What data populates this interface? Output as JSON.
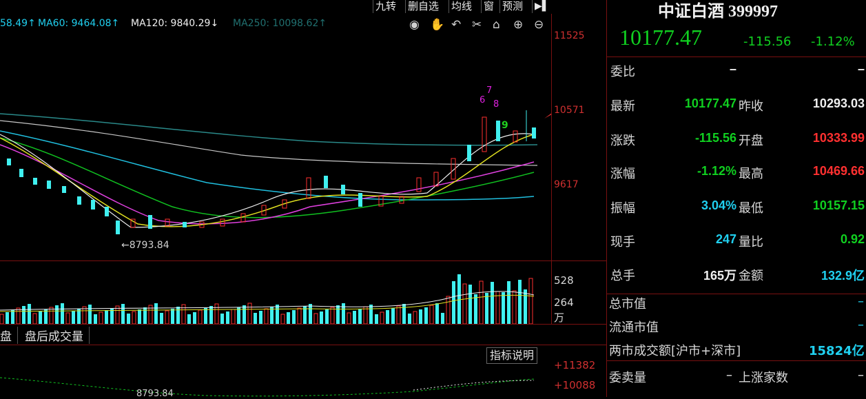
{
  "toolbar": {
    "buttons": [
      "九转",
      "删自选",
      "均线",
      "窗",
      "预测"
    ],
    "arrow_icon": "right-arrow-icon"
  },
  "ma_legend": [
    {
      "label": "58.49↑",
      "color": "#20d0f0"
    },
    {
      "label": "MA60: 9464.08↑",
      "color": "#20d0f0"
    },
    {
      "label": "MA120: 9840.29↓",
      "color": "#f0f0f0"
    },
    {
      "label": "MA250: 10098.62↑",
      "color": "#207070"
    }
  ],
  "chart_icons": [
    "eye-icon",
    "hand-icon",
    "undo-icon",
    "scissors-icon",
    "home-icon",
    "zoom-in-icon",
    "zoom-out-icon"
  ],
  "price_axis": {
    "top": "11525",
    "mid": "10571",
    "low": "9617"
  },
  "low_marker": "←8793.84",
  "td_labels": [
    {
      "text": "6",
      "color": "#e020e0"
    },
    {
      "text": "7",
      "color": "#e020e0"
    },
    {
      "text": "8",
      "color": "#e020e0"
    },
    {
      "text": "9",
      "color": "#20d020"
    }
  ],
  "volume_axis": {
    "top": "528",
    "mid": "264",
    "unit": "万"
  },
  "tabs": [
    "盘",
    "盘后成交量"
  ],
  "indicator_button": "指标说明",
  "lower_axis": {
    "top": "+11382",
    "bottom": "+10088"
  },
  "lower_low_marker": "8793.84",
  "quote": {
    "title": "中证白酒 399997",
    "price": "10177.47",
    "change": "-115.56",
    "change_pct": "-1.12%",
    "rows": [
      {
        "l1": "委比",
        "v1": "–",
        "l2": "",
        "v2": "–",
        "c1": "white",
        "c2": "white"
      },
      {
        "l1": "最新",
        "v1": "10177.47",
        "l2": "昨收",
        "v2": "10293.03",
        "c1": "green",
        "c2": "white"
      },
      {
        "l1": "涨跌",
        "v1": "-115.56",
        "l2": "开盘",
        "v2": "10333.99",
        "c1": "green",
        "c2": "red"
      },
      {
        "l1": "涨幅",
        "v1": "-1.12%",
        "l2": "最高",
        "v2": "10469.66",
        "c1": "green",
        "c2": "red"
      },
      {
        "l1": "振幅",
        "v1": "3.04%",
        "l2": "最低",
        "v2": "10157.15",
        "c1": "cyan",
        "c2": "green"
      },
      {
        "l1": "现手",
        "v1": "247",
        "l2": "量比",
        "v2": "0.92",
        "c1": "cyan",
        "c2": "green"
      },
      {
        "l1": "总手",
        "v1": "165万",
        "l2": "金额",
        "v2": "132.9亿",
        "c1": "white",
        "c2": "cyan"
      }
    ],
    "market_cap_label": "总市值",
    "market_cap_value": "–",
    "float_cap_label": "流通市值",
    "float_cap_value": "–",
    "turnover_label": "两市成交额[沪市+深市]",
    "turnover_value": "15824亿",
    "bid_ask_label": "委卖量",
    "bid_ask_value": "–",
    "rising_label": "上涨家数",
    "rising_value": "–"
  }
}
